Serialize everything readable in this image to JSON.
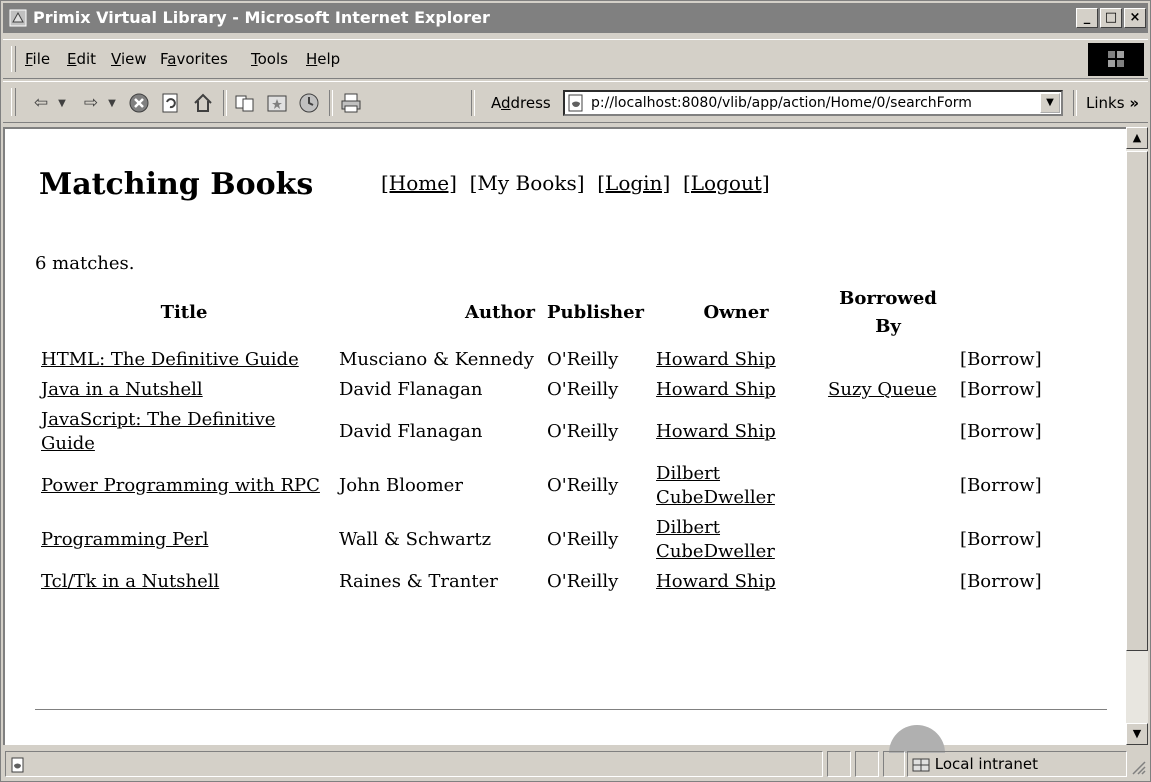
{
  "window": {
    "title": "Primix Virtual Library - Microsoft Internet Explorer",
    "controls": {
      "minimize": "_",
      "maximize": "□",
      "close": "×"
    }
  },
  "menu": [
    {
      "label": "File",
      "accel": "F",
      "rest": "ile"
    },
    {
      "label": "Edit",
      "accel": "E",
      "rest": "dit"
    },
    {
      "label": "View",
      "accel": "V",
      "rest": "iew"
    },
    {
      "label": "Favorites",
      "pre": "F",
      "accel": "a",
      "rest": "vorites"
    },
    {
      "label": "Tools",
      "accel": "T",
      "rest": "ools"
    },
    {
      "label": "Help",
      "accel": "H",
      "rest": "elp"
    }
  ],
  "toolbar": {
    "address_label_pre": "A",
    "address_label_acc": "d",
    "address_label_rest": "dress",
    "address_value": "p://localhost:8080/vlib/app/action/Home/0/searchForm",
    "links_label": "Links",
    "links_chevron": "»"
  },
  "page": {
    "title": "Matching Books",
    "nav": {
      "home": "[Home]",
      "my_books": "[My Books]",
      "login": "[Login]",
      "logout": "[Logout]"
    },
    "match_count": "6 matches.",
    "columns": [
      "Title",
      "Author",
      "Publisher",
      "Owner",
      "Borrowed By",
      ""
    ],
    "rows": [
      {
        "title": "HTML: The Definitive Guide",
        "author": "Musciano & Kennedy",
        "publisher": "O'Reilly",
        "owner": "Howard Ship",
        "borrowed_by": "",
        "action": "[Borrow]"
      },
      {
        "title": "Java in a Nutshell",
        "author": "David Flanagan",
        "publisher": "O'Reilly",
        "owner": "Howard Ship",
        "borrowed_by": "Suzy Queue",
        "action": "[Borrow]"
      },
      {
        "title": "JavaScript: The Definitive Guide",
        "author": "David Flanagan",
        "publisher": "O'Reilly",
        "owner": "Howard Ship",
        "borrowed_by": "",
        "action": "[Borrow]"
      },
      {
        "title": "Power Programming with RPC",
        "author": "John Bloomer",
        "publisher": "O'Reilly",
        "owner": "Dilbert CubeDweller",
        "borrowed_by": "",
        "action": "[Borrow]"
      },
      {
        "title": "Programming Perl",
        "author": "Wall & Schwartz",
        "publisher": "O'Reilly",
        "owner": "Dilbert CubeDweller",
        "borrowed_by": "",
        "action": "[Borrow]"
      },
      {
        "title": "Tcl/Tk in a Nutshell",
        "author": "Raines & Tranter",
        "publisher": "O'Reilly",
        "owner": "Howard Ship",
        "borrowed_by": "",
        "action": "[Borrow]"
      }
    ]
  },
  "status": {
    "zone": "Local intranet"
  },
  "colors": {
    "title_bar": "#808080",
    "chrome": "#d4d0c8",
    "content_bg": "#ffffff"
  }
}
